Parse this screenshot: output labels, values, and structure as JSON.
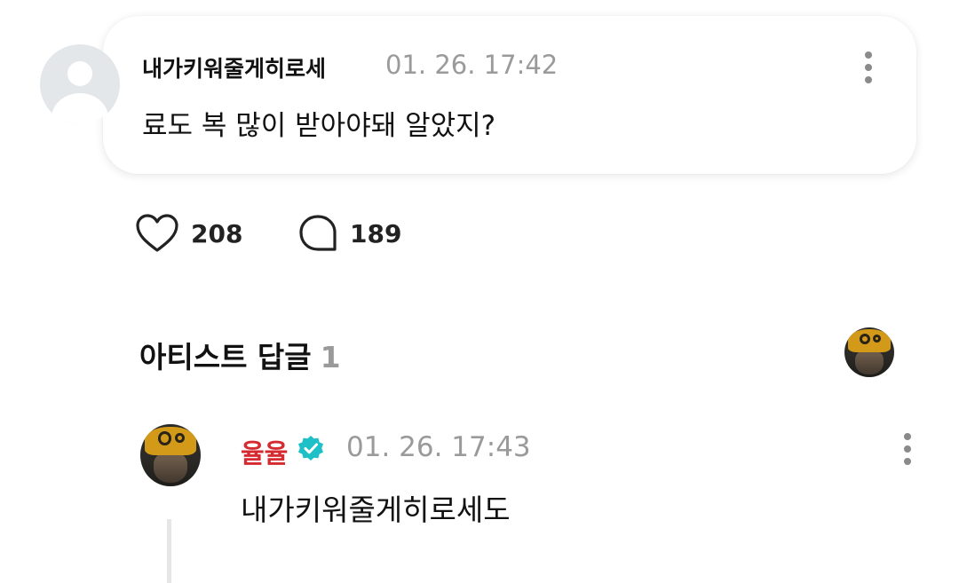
{
  "fan_comment": {
    "author": "내가키워줄게히로세",
    "timestamp": "01. 26. 17:42",
    "text": "료도 복 많이 받아야돼 알았지?",
    "avatar_icon": "default-user-icon"
  },
  "stats": {
    "likes": "208",
    "replies": "189",
    "like_icon": "heart-outline-icon",
    "reply_icon": "speech-bubble-icon"
  },
  "artist_replies": {
    "title": "아티스트 답글",
    "count": "1"
  },
  "artist_reply": {
    "author": "율율",
    "timestamp": "01. 26. 17:43",
    "text": "내가키워줄게히로세도",
    "verified_icon": "verified-badge-icon"
  },
  "colors": {
    "artist_name": "#d62a31",
    "verified_badge": "#1ec0c8",
    "timestamp": "#9a9a9a"
  }
}
